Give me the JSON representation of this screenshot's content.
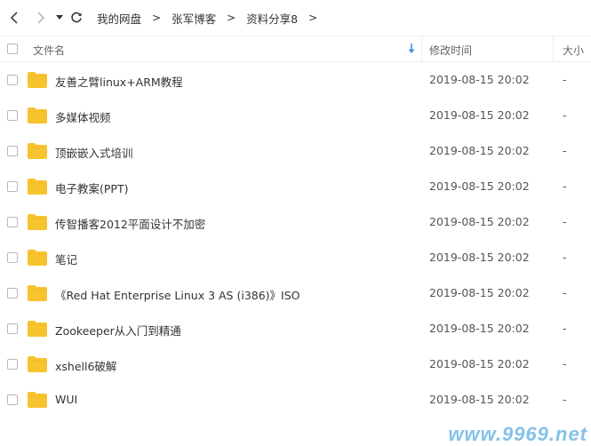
{
  "breadcrumb": [
    "我的网盘",
    "张军博客",
    "资料分享8"
  ],
  "breadcrumb_separator": ">",
  "columns": {
    "name": "文件名",
    "modified": "修改时间",
    "size": "大小"
  },
  "files": [
    {
      "name": "友善之臂linux+ARM教程",
      "modified": "2019-08-15 20:02",
      "size": "-"
    },
    {
      "name": "多媒体视频",
      "modified": "2019-08-15 20:02",
      "size": "-"
    },
    {
      "name": "顶嵌嵌入式培训",
      "modified": "2019-08-15 20:02",
      "size": "-"
    },
    {
      "name": "电子教案(PPT)",
      "modified": "2019-08-15 20:02",
      "size": "-"
    },
    {
      "name": "传智播客2012平面设计不加密",
      "modified": "2019-08-15 20:02",
      "size": "-"
    },
    {
      "name": "笔记",
      "modified": "2019-08-15 20:02",
      "size": "-"
    },
    {
      "name": "《Red Hat Enterprise Linux 3 AS (i386)》ISO",
      "modified": "2019-08-15 20:02",
      "size": "-"
    },
    {
      "name": "Zookeeper从入门到精通",
      "modified": "2019-08-15 20:02",
      "size": "-"
    },
    {
      "name": "xshell6破解",
      "modified": "2019-08-15 20:02",
      "size": "-"
    },
    {
      "name": "WUI",
      "modified": "2019-08-15 20:02",
      "size": "-"
    }
  ],
  "watermark": "www.9969.net",
  "icons": {
    "back": "chevron-left-icon",
    "forward": "chevron-right-icon",
    "dropdown": "caret-down-icon",
    "refresh": "refresh-icon",
    "sort": "sort-down-icon",
    "folder": "folder-icon"
  },
  "colors": {
    "folder": "#f7c32e",
    "sort_arrow": "#3b8fe8",
    "border": "#eeeeee"
  }
}
